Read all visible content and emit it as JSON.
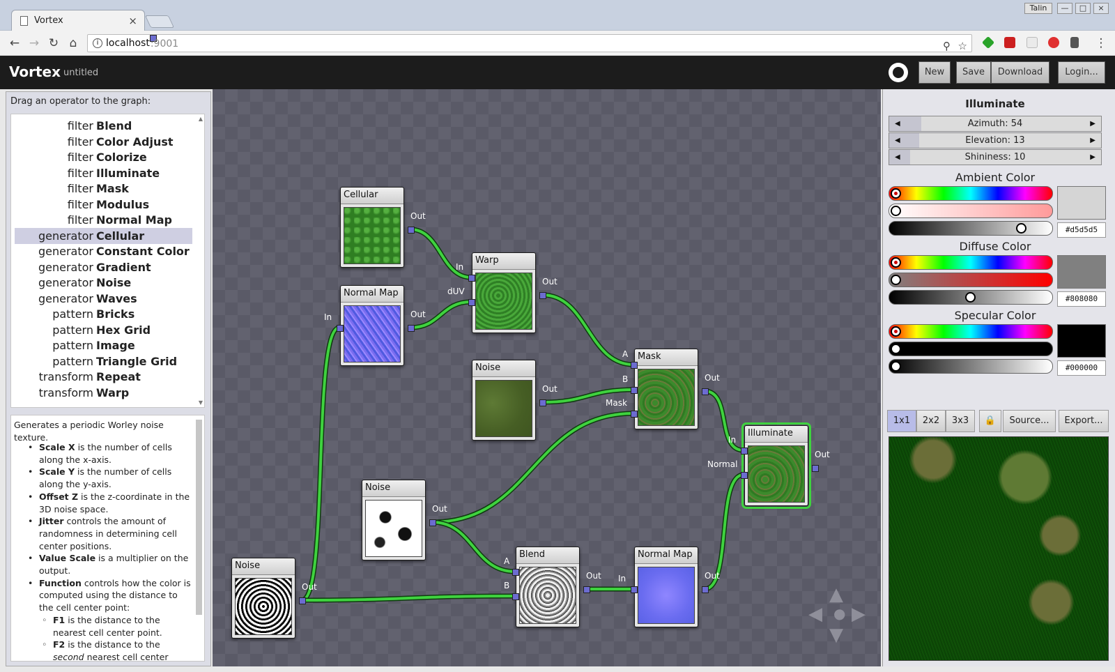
{
  "browser": {
    "tab_title": "Vortex",
    "tab_close": "×",
    "user_badge": "Talin",
    "window_buttons": [
      "—",
      "□",
      "×"
    ],
    "url_host": "localhost",
    "url_port": ":9001",
    "info_icon": "i",
    "nav_icons": [
      "back-icon",
      "forward-icon",
      "reload-icon",
      "home-icon"
    ],
    "nav_glyphs": [
      "←",
      "→",
      "↻",
      "⌂"
    ],
    "omnibox_icons": [
      "zoom-icon",
      "star-icon"
    ],
    "omnibox_glyphs": [
      "⚲",
      "☆"
    ],
    "menu_glyph": "⋮"
  },
  "app": {
    "name": "Vortex",
    "separator": "-",
    "document": "untitled",
    "buttons": {
      "new": "New",
      "save": "Save",
      "download": "Download",
      "login": "Login..."
    }
  },
  "left": {
    "heading": "Drag an operator to the graph:",
    "operators": [
      {
        "category": "filter",
        "name": "Blend"
      },
      {
        "category": "filter",
        "name": "Color Adjust"
      },
      {
        "category": "filter",
        "name": "Colorize"
      },
      {
        "category": "filter",
        "name": "Illuminate"
      },
      {
        "category": "filter",
        "name": "Mask"
      },
      {
        "category": "filter",
        "name": "Modulus"
      },
      {
        "category": "filter",
        "name": "Normal Map"
      },
      {
        "category": "generator",
        "name": "Cellular",
        "selected": true
      },
      {
        "category": "generator",
        "name": "Constant Color"
      },
      {
        "category": "generator",
        "name": "Gradient"
      },
      {
        "category": "generator",
        "name": "Noise"
      },
      {
        "category": "generator",
        "name": "Waves"
      },
      {
        "category": "pattern",
        "name": "Bricks"
      },
      {
        "category": "pattern",
        "name": "Hex Grid"
      },
      {
        "category": "pattern",
        "name": "Image"
      },
      {
        "category": "pattern",
        "name": "Triangle Grid"
      },
      {
        "category": "transform",
        "name": "Repeat"
      },
      {
        "category": "transform",
        "name": "Warp"
      }
    ],
    "description": {
      "intro": "Generates a periodic Worley noise texture.",
      "items": [
        {
          "term": "Scale X",
          "text": " is the number of cells along the x-axis."
        },
        {
          "term": "Scale Y",
          "text": " is the number of cells along the y-axis."
        },
        {
          "term": "Offset Z",
          "text": " is the z-coordinate in the 3D noise space."
        },
        {
          "term": "Jitter",
          "text": " controls the amount of randomness in determining cell center positions."
        },
        {
          "term": "Value Scale",
          "text": " is a multiplier on the output."
        },
        {
          "term": "Function",
          "text": " controls how the color is computed using the distance to the cell center point:"
        }
      ],
      "subitems": [
        {
          "term": "F1",
          "text": " is the distance to the nearest cell center point."
        },
        {
          "term": "F2",
          "text": " is the distance to the ",
          "em": "second",
          "tail": " nearest cell center"
        }
      ]
    }
  },
  "graph": {
    "nodes": {
      "cellular": {
        "title": "Cellular",
        "out": "Out"
      },
      "normalmap1": {
        "title": "Normal Map",
        "in": "In",
        "out": "Out"
      },
      "warp": {
        "title": "Warp",
        "in": "In",
        "duv": "dUV",
        "out": "Out"
      },
      "noise1": {
        "title": "Noise",
        "out": "Out"
      },
      "mask": {
        "title": "Mask",
        "a": "A",
        "b": "B",
        "mask": "Mask",
        "out": "Out"
      },
      "illuminate": {
        "title": "Illuminate",
        "in": "In",
        "normal": "Normal",
        "out": "Out"
      },
      "noise2": {
        "title": "Noise",
        "out": "Out"
      },
      "noise3": {
        "title": "Noise",
        "out": "Out"
      },
      "blend": {
        "title": "Blend",
        "a": "A",
        "b": "B",
        "out": "Out"
      },
      "normalmap2": {
        "title": "Normal Map",
        "in": "In",
        "out": "Out"
      }
    },
    "nav": [
      "pan-up-icon",
      "pan-left-icon",
      "center-icon",
      "pan-right-icon",
      "pan-down-icon"
    ],
    "nav_glyphs": {
      "up": "▲",
      "left": "◀",
      "center": "●",
      "right": "▶",
      "down": "▼"
    }
  },
  "right": {
    "title": "Illuminate",
    "sliders": [
      {
        "label": "Azimuth: 54",
        "fraction": 0.15
      },
      {
        "label": "Elevation: 13",
        "fraction": 0.14
      },
      {
        "label": "Shininess: 10",
        "fraction": 0.1
      }
    ],
    "arrows": {
      "left": "◀",
      "right": "▶"
    },
    "colors": [
      {
        "title": "Ambient Color",
        "hex": "#d5d5d5",
        "swatch": "#d5d5d5",
        "sat_from": "#ffffff",
        "sat_to": "#ff9a9a",
        "value": 0.84,
        "sat": 0.0
      },
      {
        "title": "Diffuse Color",
        "hex": "#808080",
        "swatch": "#808080",
        "sat_from": "#808080",
        "sat_to": "#ff0000",
        "value": 0.5,
        "sat": 0.0
      },
      {
        "title": "Specular Color",
        "hex": "#000000",
        "swatch": "#000000",
        "sat_from": "#000000",
        "sat_to": "#000000",
        "value": 0.0,
        "sat": 0.0
      }
    ],
    "tabs": [
      "1x1",
      "2x2",
      "3x3",
      "Source...",
      "Export..."
    ],
    "lock_icon": "lock-icon",
    "lock_glyph": "🔒",
    "active_tab": "1x1"
  }
}
